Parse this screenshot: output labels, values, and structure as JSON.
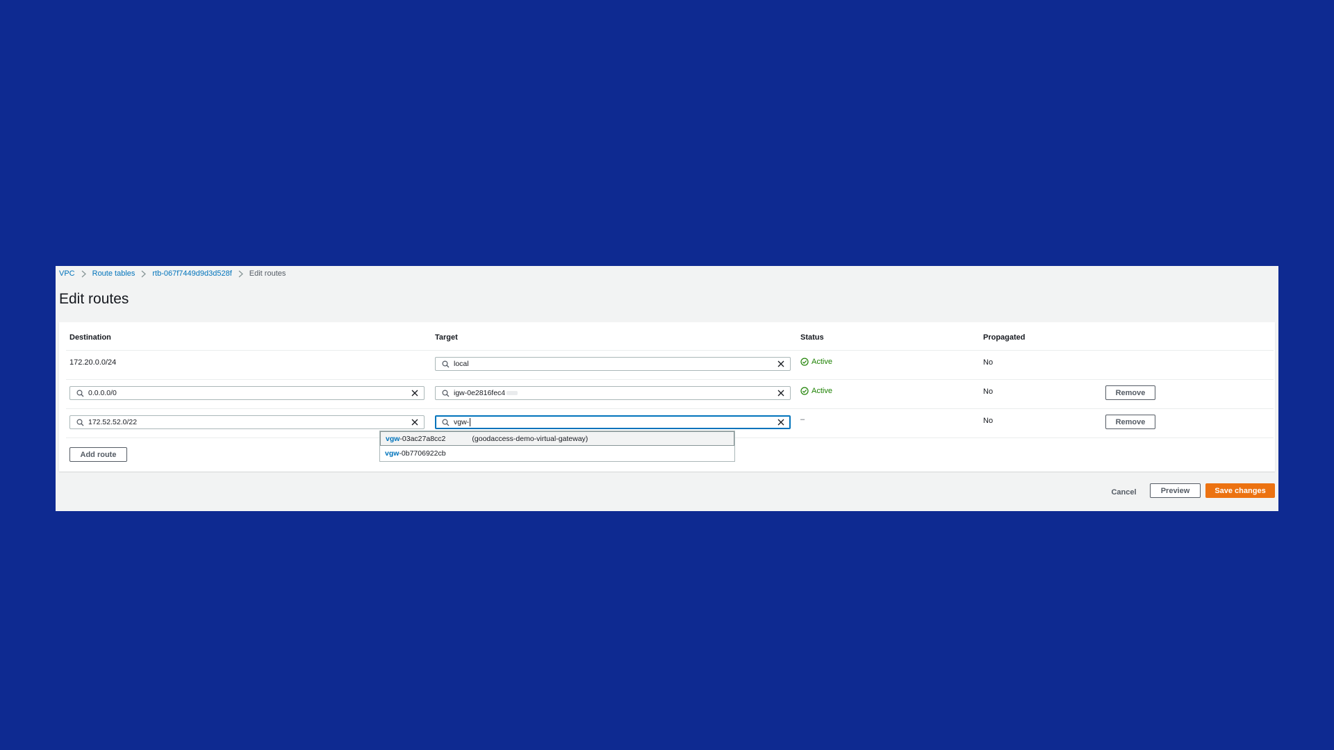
{
  "breadcrumb": {
    "items": [
      "VPC",
      "Route tables",
      "rtb-067f7449d9d3d528f"
    ],
    "current": "Edit routes"
  },
  "page": {
    "title": "Edit routes"
  },
  "table": {
    "headers": {
      "destination": "Destination",
      "target": "Target",
      "status": "Status",
      "propagated": "Propagated"
    },
    "rows": [
      {
        "destination": "172.20.0.0/24",
        "target": "local",
        "status": "Active",
        "propagated": "No"
      },
      {
        "destination": "0.0.0.0/0",
        "target": "igw-0e2816fec4",
        "status": "Active",
        "propagated": "No",
        "remove_label": "Remove"
      },
      {
        "destination": "172.52.52.0/22",
        "target": "vgw-",
        "status": "–",
        "propagated": "No",
        "remove_label": "Remove"
      }
    ]
  },
  "dropdown": {
    "options": [
      {
        "match": "vgw",
        "rest": "-03ac27a8cc2",
        "name": "(goodaccess-demo-virtual-gateway)"
      },
      {
        "match": "vgw",
        "rest": "-0b7706922cb",
        "name": ""
      }
    ]
  },
  "actions": {
    "add_route": "Add route",
    "cancel": "Cancel",
    "preview": "Preview",
    "save": "Save changes"
  },
  "colors": {
    "background": "#0e2a91",
    "link": "#0073bb",
    "active": "#1d8102",
    "primary": "#ec7211"
  },
  "icons": [
    "search-icon",
    "clear-icon",
    "check-circle-icon",
    "chevron-right-icon"
  ]
}
